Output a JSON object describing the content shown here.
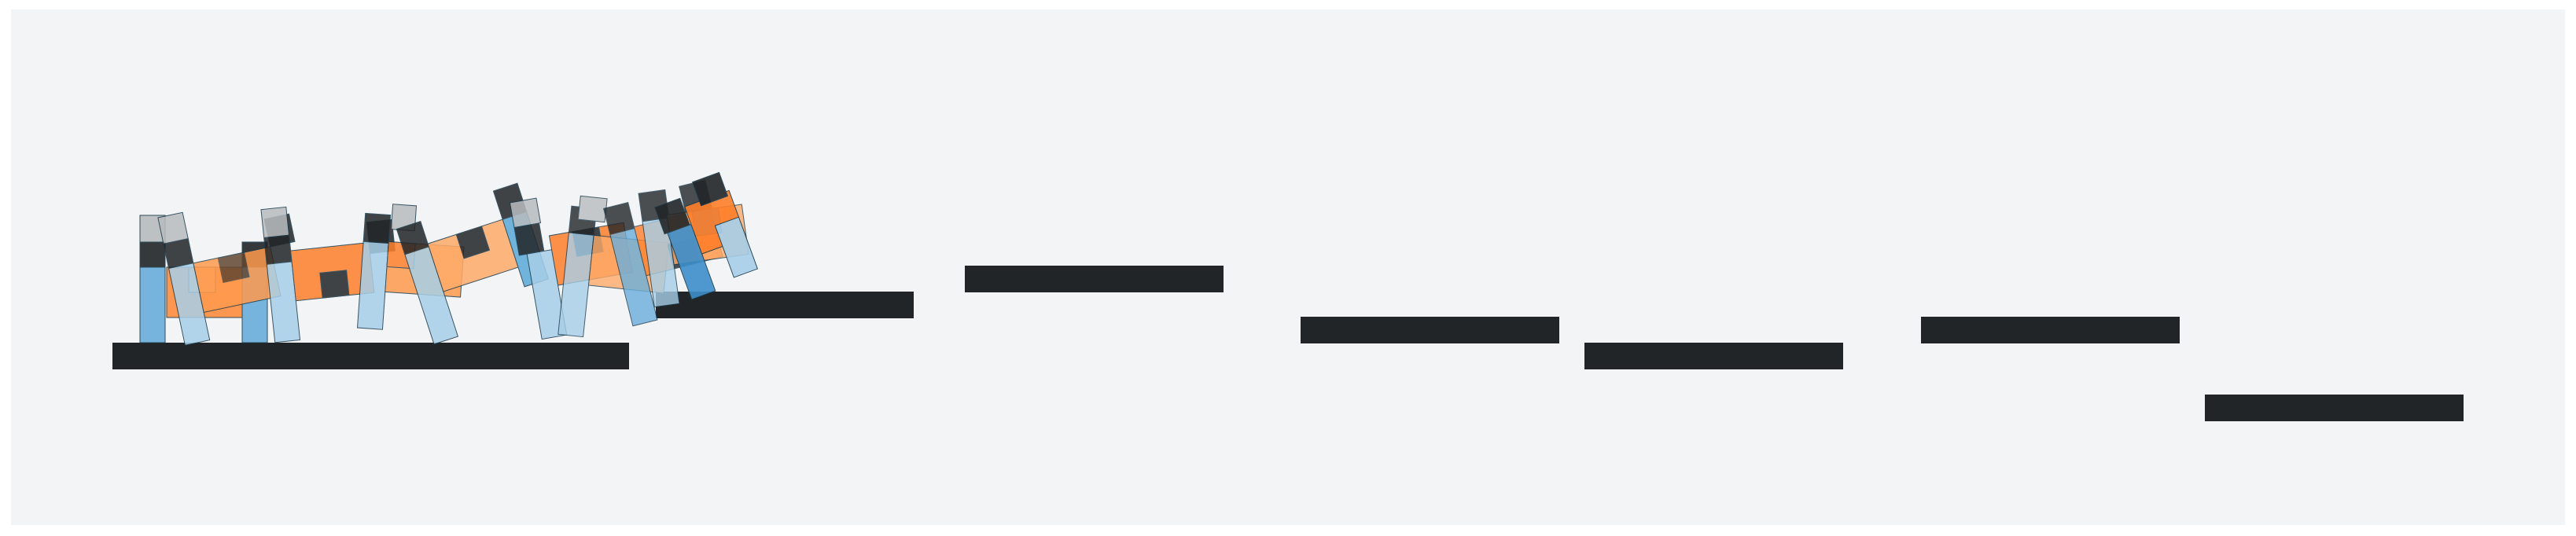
{
  "scene": {
    "background": "#f2f4f6",
    "frame": "#ffffff",
    "platform_color": "#222527",
    "colors": {
      "torso_orange": "#ff7f2a",
      "torso_light": "#ffab6a",
      "leg_blue": "#5aa9d8",
      "leg_light": "#a7cfe8",
      "joint_dark": "#222527",
      "head_grey": "#b8bcbe"
    },
    "platform_count": 8,
    "robot_pose_count": 10
  }
}
